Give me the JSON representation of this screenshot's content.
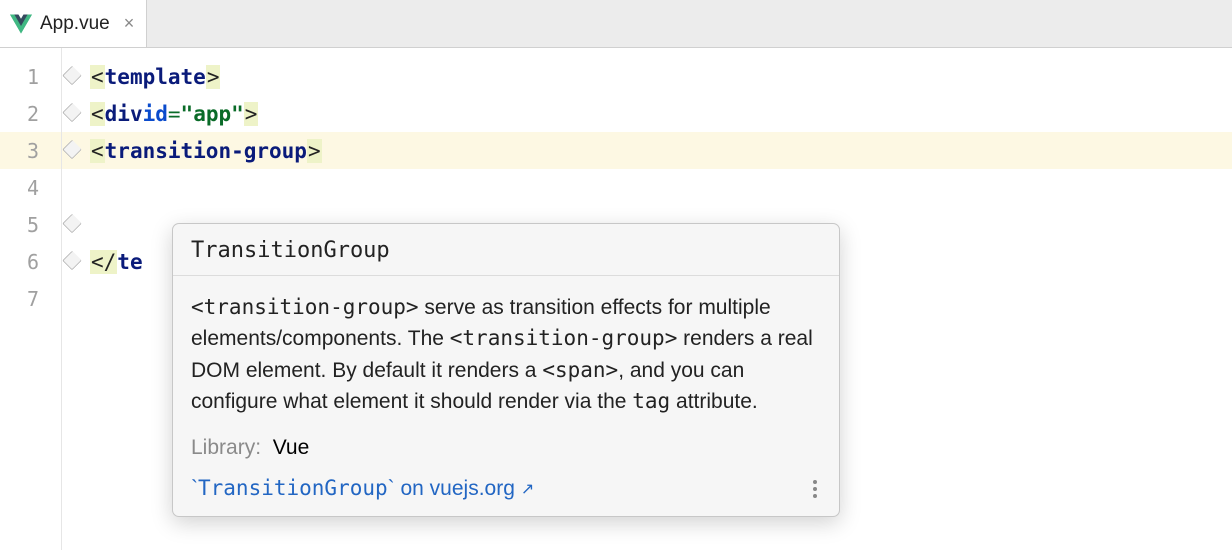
{
  "tab": {
    "filename": "App.vue"
  },
  "gutter": [
    "1",
    "2",
    "3",
    "4",
    "5",
    "6",
    "7"
  ],
  "code": {
    "l1": {
      "open": "<",
      "tag": "template",
      "close": ">"
    },
    "l2": {
      "open": "<",
      "tag": "div",
      "attr": "id",
      "eq": "=",
      "str": "\"app\"",
      "close": ">"
    },
    "l3": {
      "open": "<",
      "tag": "transition-group",
      "close": ">"
    },
    "l5": {
      "indent": "    "
    },
    "l6": {
      "open": "</",
      "tag": "te"
    }
  },
  "popup": {
    "title": "TransitionGroup",
    "desc_parts": {
      "p1": "<transition-group>",
      "p2": " serve as transition effects for multiple elements/components. The ",
      "p3": "<transition-group>",
      "p4": " renders a real DOM element. By default it renders a ",
      "p5": "<span>",
      "p6": ", and you can configure what element it should render via the ",
      "p7": "tag",
      "p8": " attribute."
    },
    "library_key": "Library:",
    "library_val": "Vue",
    "link_pre": "`",
    "link_mono": "TransitionGroup",
    "link_post": "` on vuejs.org"
  }
}
